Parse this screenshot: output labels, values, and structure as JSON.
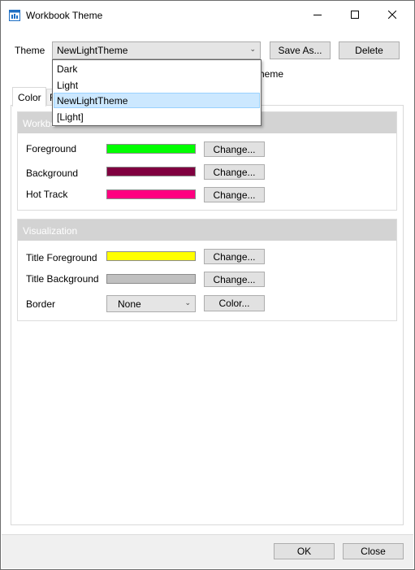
{
  "window": {
    "title": "Workbook Theme",
    "icon": "workbook-theme-icon",
    "controls": [
      "minimize-icon",
      "maximize-icon",
      "close-icon"
    ]
  },
  "theme": {
    "label": "Theme",
    "selected": "NewLightTheme",
    "save_as_label": "Save As...",
    "delete_label": "Delete",
    "behind_text": "heme",
    "options": [
      "Dark",
      "Light",
      "NewLightTheme",
      "[Light]"
    ],
    "highlighted_option": "NewLightTheme"
  },
  "tabs": [
    {
      "label": "Color",
      "active": true
    },
    {
      "label": "F",
      "active": false
    }
  ],
  "groups": {
    "workbook": {
      "header": "Workbo",
      "rows": [
        {
          "label": "Foreground",
          "color": "#00ff00",
          "button": "Change..."
        },
        {
          "label": "Background",
          "color": "#800040",
          "button": "Change..."
        },
        {
          "label": "Hot Track",
          "color": "#ff0080",
          "button": "Change..."
        }
      ]
    },
    "visualization": {
      "header": "Visualization",
      "rows": [
        {
          "label": "Title Foreground",
          "color": "#ffff00",
          "button": "Change..."
        },
        {
          "label": "Title Background",
          "color": "#c0c0c0",
          "button": "Change..."
        }
      ],
      "border": {
        "label": "Border",
        "selected": "None",
        "button": "Color..."
      }
    }
  },
  "footer": {
    "ok_label": "OK",
    "close_label": "Close"
  },
  "colors": {
    "group_header": "#d3d3d3",
    "selection": "#cce8ff",
    "button_face": "#e1e1e1"
  }
}
